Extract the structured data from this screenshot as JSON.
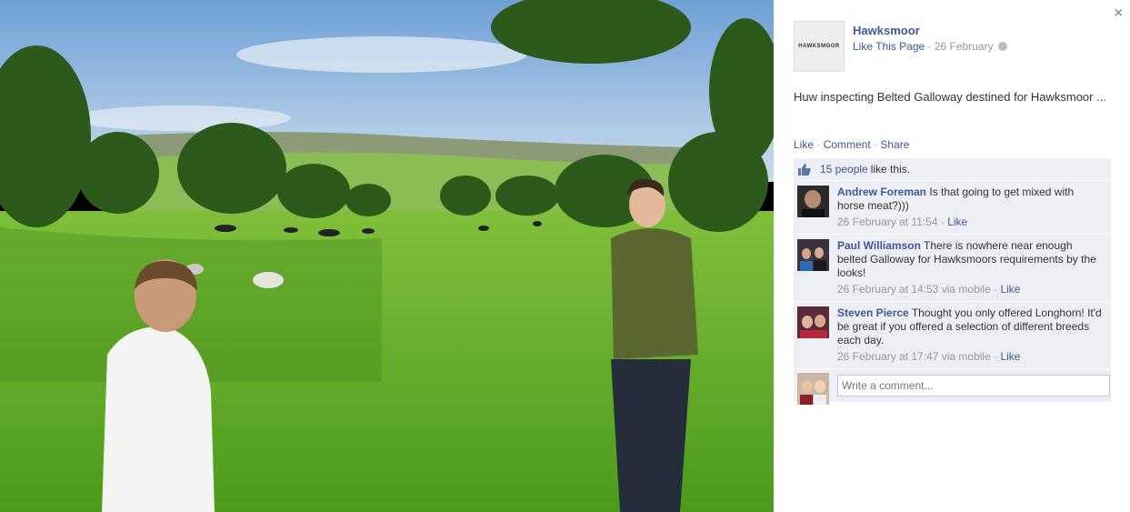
{
  "photo": {
    "alt": ""
  },
  "panel": {
    "close_glyph": "×",
    "page": {
      "logo_text": "HAWKSMOOR",
      "name": "Hawksmoor",
      "like_link": "Like This Page",
      "separator": "·",
      "date": "26 February"
    },
    "caption": "Huw inspecting Belted Galloway destined for Hawksmoor ...",
    "actions": {
      "like": "Like",
      "comment": "Comment",
      "share": "Share",
      "separator": "·"
    },
    "likes": {
      "count_link": "15 people",
      "suffix": "like this."
    },
    "comments": [
      {
        "author": "Andrew Foreman",
        "text": "Is that going to get mixed with horse meat?)))",
        "time": "26 February at 11:54",
        "via": "",
        "like": "Like"
      },
      {
        "author": "Paul Williamson",
        "text": "There is nowhere near enough belted Galloway for Hawksmoors requirements by the looks!",
        "time": "26 February at 14:53",
        "via": "via mobile",
        "like": "Like"
      },
      {
        "author": "Steven Pierce",
        "text": "Thought you only offered Longhorn! It'd be great if you offered a selection of different breeds each day.",
        "time": "26 February at 17:47",
        "via": "via mobile",
        "like": "Like"
      }
    ],
    "write_placeholder": "Write a comment...",
    "colors": {
      "link": "#3b5998",
      "feed_bg": "#edeff4",
      "muted": "#999999"
    }
  }
}
